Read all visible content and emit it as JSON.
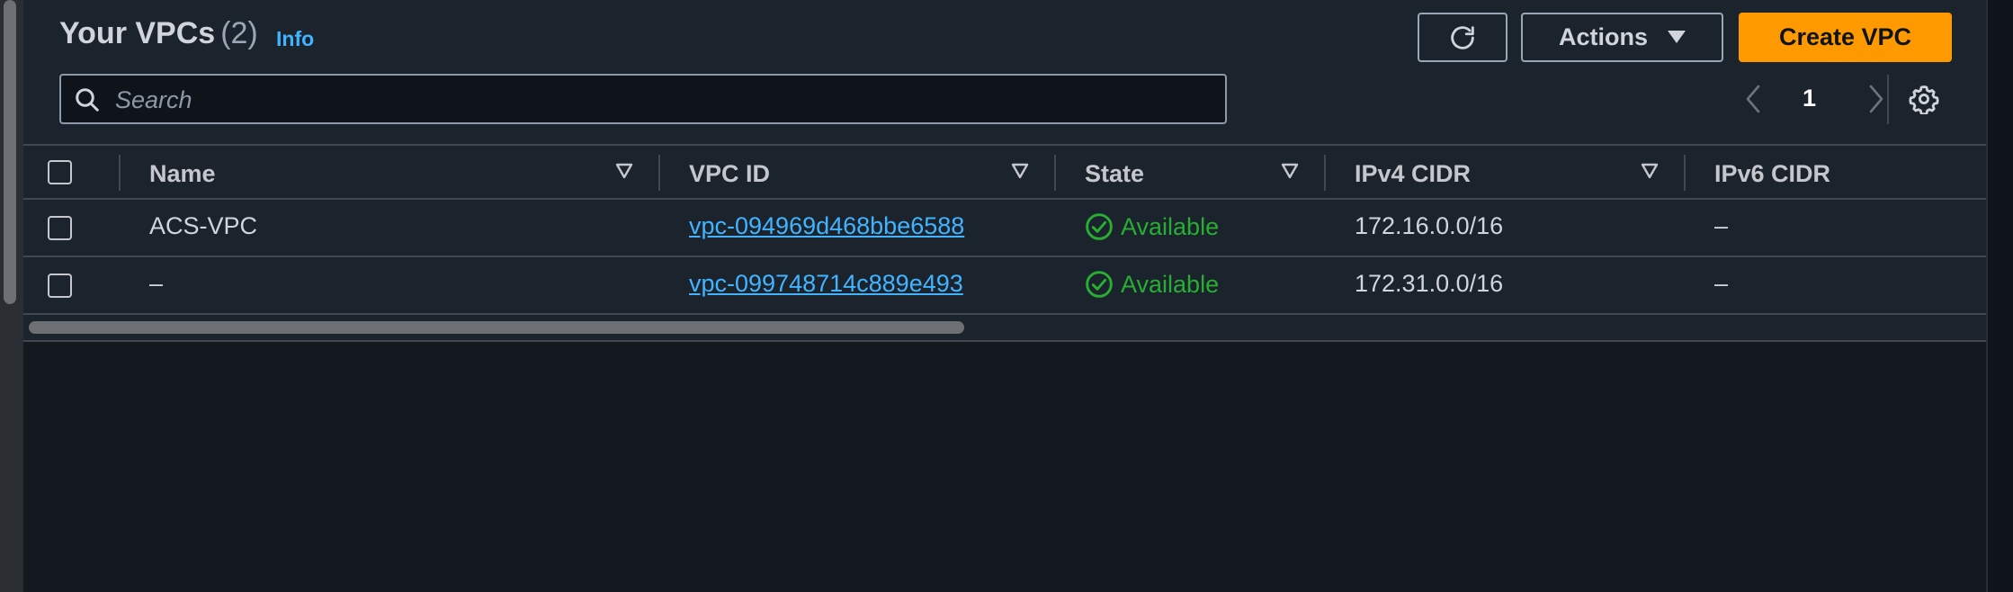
{
  "header": {
    "title": "Your VPCs",
    "count": "(2)",
    "info_label": "Info"
  },
  "toolbar": {
    "actions_label": "Actions",
    "create_label": "Create VPC"
  },
  "search": {
    "placeholder": "Search"
  },
  "pagination": {
    "current_page": "1"
  },
  "table": {
    "columns": [
      "Name",
      "VPC ID",
      "State",
      "IPv4 CIDR",
      "IPv6 CIDR"
    ],
    "rows": [
      {
        "name": "ACS-VPC",
        "vpc_id": "vpc-094969d468bbe6588",
        "state": "Available",
        "ipv4": "172.16.0.0/16",
        "ipv6": "–"
      },
      {
        "name": "–",
        "vpc_id": "vpc-099748714c889e493",
        "state": "Available",
        "ipv4": "172.31.0.0/16",
        "ipv6": "–"
      }
    ]
  },
  "colors": {
    "accent": "#ff9900",
    "link": "#42b4ff",
    "success": "#29ad32"
  },
  "icons": [
    "refresh-icon",
    "caret-down-icon",
    "search-icon",
    "chevron-left-icon",
    "chevron-right-icon",
    "settings-icon",
    "sort-icon",
    "status-check-icon"
  ]
}
